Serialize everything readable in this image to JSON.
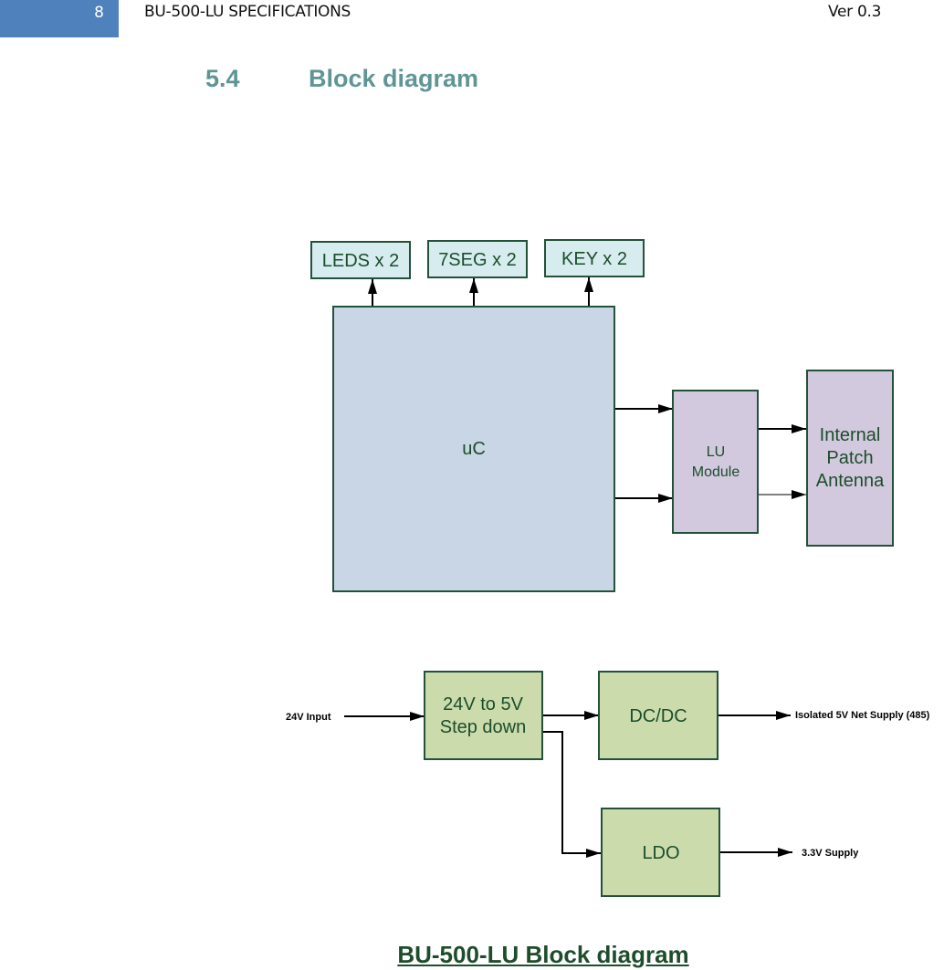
{
  "header": {
    "page_number": "8",
    "document_title": "BU-500-LU SPECIFICATIONS",
    "version": "Ver 0.3",
    "tab_color": "#4f81bd"
  },
  "section": {
    "number": "5.4",
    "title": "Block diagram",
    "color": "#5f9595"
  },
  "diagram": {
    "top": {
      "peripherals": [
        {
          "label": "LEDS x 2"
        },
        {
          "label": "7SEG x 2"
        },
        {
          "label": "KEY x 2"
        }
      ],
      "microcontroller": {
        "label": "uC"
      },
      "lu_module": {
        "line1": "LU",
        "line2": "Module"
      },
      "antenna": {
        "line1": "Internal",
        "line2": "Patch",
        "line3": "Antenna"
      }
    },
    "power": {
      "input_label": "24V Input",
      "step_down": {
        "line1": "24V to 5V",
        "line2": "Step down"
      },
      "dcdc": {
        "label": "DC/DC"
      },
      "ldo": {
        "label": "LDO"
      },
      "isolated_output_label": "Isolated 5V Net Supply (485)",
      "ldo_output_label": "3.3V Supply"
    },
    "colors": {
      "peripheral_fill": "#d6ecef",
      "uc_fill": "#c9d6e6",
      "module_fill": "#d3c9de",
      "power_fill": "#ccdbac",
      "border": "#24513a",
      "text": "#1b4d2b"
    }
  },
  "caption": "BU-500-LU Block diagram"
}
